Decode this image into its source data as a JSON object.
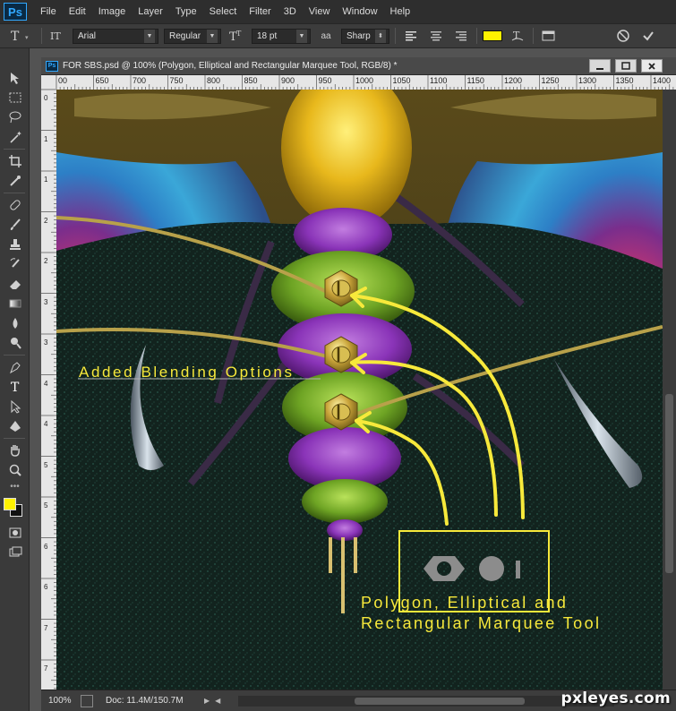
{
  "app": {
    "logo": "Ps"
  },
  "menu": [
    "File",
    "Edit",
    "Image",
    "Layer",
    "Type",
    "Select",
    "Filter",
    "3D",
    "View",
    "Window",
    "Help"
  ],
  "options_bar": {
    "font_family": "Arial",
    "font_style": "Regular",
    "font_size": "18 pt",
    "antialias_icon": "aa",
    "antialias": "Sharp",
    "text_color": "#fff200"
  },
  "document": {
    "ps_badge": "Ps",
    "title": "FOR SBS.psd @ 100% (Polygon, Elliptical and Rectangular Marquee Tool, RGB/8) *",
    "ruler_top": [
      "00",
      "650",
      "700",
      "750",
      "800",
      "850",
      "900",
      "950",
      "1000",
      "1050",
      "1100",
      "1150",
      "1200",
      "1250",
      "1300",
      "1350",
      "1400"
    ],
    "ruler_left": [
      "0",
      "1",
      "1",
      "2",
      "2",
      "3",
      "3",
      "4",
      "4",
      "5",
      "5",
      "6",
      "6",
      "7",
      "7"
    ]
  },
  "canvas_text": {
    "blending_label": "Added Blending Options",
    "marquee_label_line1": "Polygon, Elliptical and",
    "marquee_label_line2": "Rectangular Marquee Tool"
  },
  "status": {
    "zoom": "100%",
    "doc_size": "Doc: 11.4M/150.7M"
  },
  "watermark": "pxleyes.com",
  "colors": {
    "foreground": "#fff200",
    "background": "#111111",
    "annotation": "#f7e93b"
  }
}
